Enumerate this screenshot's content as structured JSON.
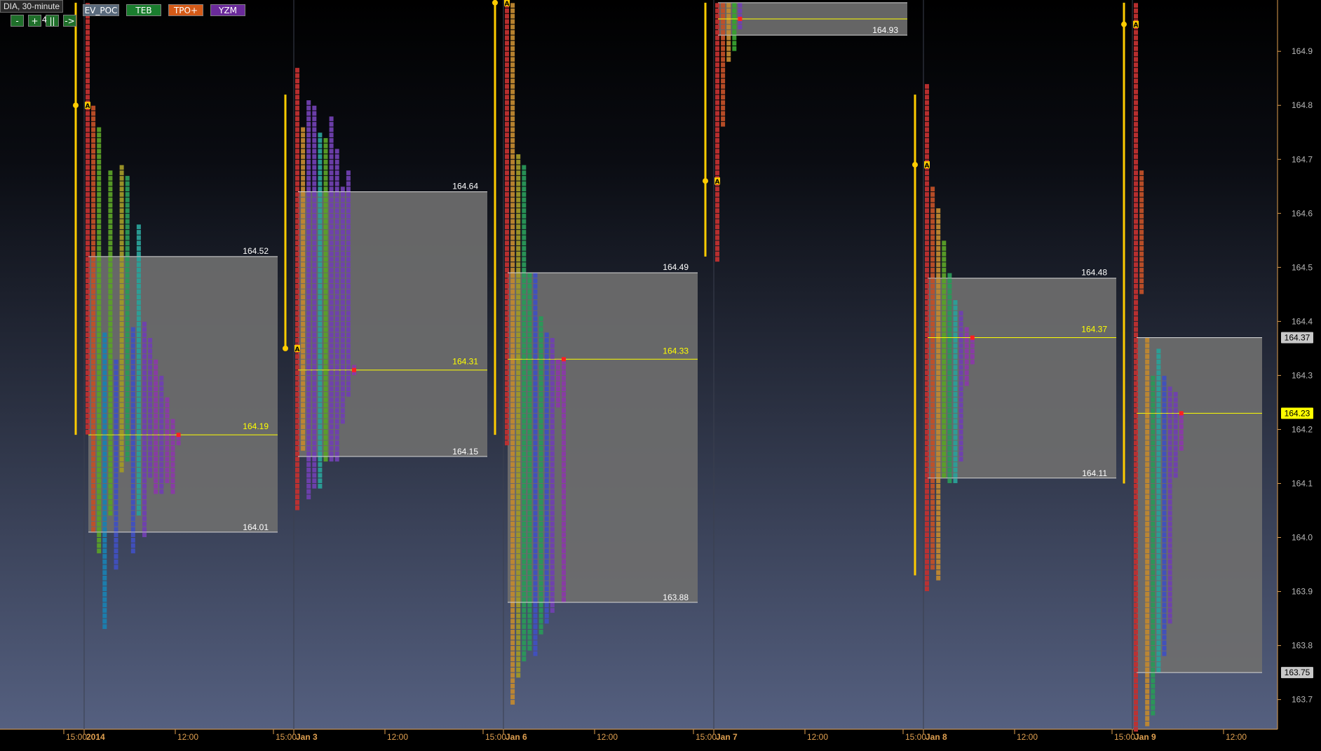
{
  "window": {
    "title": "DIA, 30-minute"
  },
  "toolbar": {
    "buttons": [
      {
        "label": "-",
        "name": "zoom-out-button"
      },
      {
        "label": "+",
        "name": "zoom-in-button"
      },
      {
        "label": "||",
        "name": "pause-button"
      },
      {
        "label": "->",
        "name": "scroll-right-button"
      }
    ],
    "hidden_label": "4",
    "tags": [
      {
        "label": "EV_POC",
        "bg": "#5a6a7c",
        "fg": "#ffffff"
      },
      {
        "label": "TEB",
        "bg": "#1a7d2e",
        "fg": "#ffffff"
      },
      {
        "label": "TPO+",
        "bg": "#d45a18",
        "fg": "#ffffff"
      },
      {
        "label": "YZM",
        "bg": "#6a2a9a",
        "fg": "#ffffff"
      }
    ]
  },
  "colors": {
    "bg_top": "#000000",
    "bg_bottom": "#556080",
    "axis_text": "#e0a050",
    "price_axis_text": "#b8b8b8",
    "value_area": "#6e6e6e",
    "poc_line": "#ffff00",
    "ib_line": "#ffcc00",
    "value_label": "#ffffff",
    "poc_label": "#ffff00",
    "tpo_A": "#c03030",
    "tpo_B": "#c05028",
    "tpo_C": "#c08830",
    "tpo_D": "#a09828",
    "tpo_E": "#5aa028",
    "tpo_F": "#38a030",
    "tpo_G": "#2a9858",
    "tpo_H": "#2aa098",
    "tpo_I": "#1a80b0",
    "tpo_X": "#4050c0",
    "tpo_Y": "#7040b0",
    "tpo_Z": "#8a3aa8",
    "poc_marker": "#ff2020"
  },
  "chart_data": {
    "type": "market-profile",
    "symbol": "DIA",
    "interval": "30-minute",
    "y_axis": {
      "ticks": [
        164.9,
        164.8,
        164.7,
        164.6,
        164.5,
        164.4,
        164.3,
        164.2,
        164.1,
        164.0,
        163.9,
        163.8,
        163.7
      ],
      "range": [
        163.645,
        164.995
      ],
      "highlighted": [
        {
          "value": 164.37,
          "label": "164.37",
          "bg": "#c8c8c8",
          "fg": "#000000"
        },
        {
          "value": 164.23,
          "label": "164.23",
          "bg": "#ffff00",
          "fg": "#000000"
        },
        {
          "value": 163.75,
          "label": "163.75",
          "bg": "#c8c8c8",
          "fg": "#000000"
        }
      ]
    },
    "x_axis": {
      "labels": [
        {
          "text": "15:00",
          "bold": false
        },
        {
          "text": "2014",
          "bold": true
        },
        {
          "text": "12:00",
          "bold": false
        },
        {
          "text": "15:00",
          "bold": false
        },
        {
          "text": "Jan 3",
          "bold": true
        },
        {
          "text": "12:00",
          "bold": false
        },
        {
          "text": "15:00",
          "bold": false
        },
        {
          "text": "Jan 6",
          "bold": true
        },
        {
          "text": "12:00",
          "bold": false
        },
        {
          "text": "15:00",
          "bold": false
        },
        {
          "text": "Jan 7",
          "bold": true
        },
        {
          "text": "12:00",
          "bold": false
        },
        {
          "text": "15:00",
          "bold": false
        },
        {
          "text": "Jan 8",
          "bold": true
        },
        {
          "text": "12:00",
          "bold": false
        },
        {
          "text": "15:00",
          "bold": false
        },
        {
          "text": "Jan 9",
          "bold": true
        },
        {
          "text": "12:00",
          "bold": false
        }
      ]
    },
    "sessions": [
      {
        "date": "2014",
        "value_area_high": 164.52,
        "value_area_low": 164.01,
        "poc": 164.19,
        "vah_label": "164.52",
        "val_label": "164.01",
        "poc_label": "164.19",
        "ib_high": 164.99,
        "ib_low": 164.19,
        "open": 164.8,
        "open_letter": "A",
        "periods": [
          {
            "letter": "A",
            "color": "tpo_A",
            "high": 164.99,
            "low": 164.2
          },
          {
            "letter": "B",
            "color": "tpo_B",
            "high": 164.8,
            "low": 164.02
          },
          {
            "letter": "E",
            "color": "tpo_E",
            "high": 164.76,
            "low": 163.98
          },
          {
            "letter": "I",
            "color": "tpo_I",
            "high": 164.38,
            "low": 163.84
          },
          {
            "letter": "E",
            "color": "tpo_E",
            "high": 164.68,
            "low": 164.05
          },
          {
            "letter": "X",
            "color": "tpo_X",
            "high": 164.33,
            "low": 163.95
          },
          {
            "letter": "D",
            "color": "tpo_D",
            "high": 164.69,
            "low": 164.13
          },
          {
            "letter": "G",
            "color": "tpo_G",
            "high": 164.67,
            "low": 164.15
          },
          {
            "letter": "X",
            "color": "tpo_X",
            "high": 164.39,
            "low": 163.98
          },
          {
            "letter": "H",
            "color": "tpo_H",
            "high": 164.58,
            "low": 164.05
          },
          {
            "letter": "Y",
            "color": "tpo_Y",
            "high": 164.4,
            "low": 164.01
          },
          {
            "letter": "Y",
            "color": "tpo_Y",
            "high": 164.37,
            "low": 164.12
          },
          {
            "letter": "Z",
            "color": "tpo_Z",
            "high": 164.33,
            "low": 164.09
          },
          {
            "letter": "Y",
            "color": "tpo_Y",
            "high": 164.3,
            "low": 164.09
          },
          {
            "letter": "Z",
            "color": "tpo_Z",
            "high": 164.26,
            "low": 164.11
          },
          {
            "letter": "Z",
            "color": "tpo_Z",
            "high": 164.22,
            "low": 164.09
          },
          {
            "letter": "Z",
            "color": "tpo_Z",
            "high": 164.19,
            "low": 164.19
          }
        ]
      },
      {
        "date": "Jan 3",
        "value_area_high": 164.64,
        "value_area_low": 164.15,
        "poc": 164.31,
        "vah_label": "164.64",
        "val_label": "164.15",
        "poc_label": "164.31",
        "ib_high": 164.82,
        "ib_low": 164.35,
        "open": 164.35,
        "open_letter": "A",
        "periods": [
          {
            "letter": "A",
            "color": "tpo_A",
            "high": 164.87,
            "low": 164.06
          },
          {
            "letter": "C",
            "color": "tpo_C",
            "high": 164.76,
            "low": 164.17
          },
          {
            "letter": "Y",
            "color": "tpo_Y",
            "high": 164.81,
            "low": 164.08
          },
          {
            "letter": "Y",
            "color": "tpo_Y",
            "high": 164.8,
            "low": 164.1
          },
          {
            "letter": "H",
            "color": "tpo_H",
            "high": 164.75,
            "low": 164.1
          },
          {
            "letter": "E",
            "color": "tpo_E",
            "high": 164.74,
            "low": 164.15
          },
          {
            "letter": "Y",
            "color": "tpo_Y",
            "high": 164.78,
            "low": 164.15
          },
          {
            "letter": "Y",
            "color": "tpo_Y",
            "high": 164.72,
            "low": 164.15
          },
          {
            "letter": "Y",
            "color": "tpo_Y",
            "high": 164.65,
            "low": 164.22
          },
          {
            "letter": "Y",
            "color": "tpo_Y",
            "high": 164.68,
            "low": 164.27
          },
          {
            "letter": "Z",
            "color": "tpo_Z",
            "high": 164.32,
            "low": 164.32
          }
        ]
      },
      {
        "date": "Jan 6",
        "value_area_high": 164.49,
        "value_area_low": 163.88,
        "poc": 164.33,
        "vah_label": "164.49",
        "val_label": "163.88",
        "poc_label": "164.33",
        "ib_high": 164.99,
        "ib_low": 164.19,
        "open": 164.99,
        "open_letter": "A",
        "periods": [
          {
            "letter": "A",
            "color": "tpo_A",
            "high": 164.99,
            "low": 164.18
          },
          {
            "letter": "C",
            "color": "tpo_C",
            "high": 164.99,
            "low": 163.7
          },
          {
            "letter": "D",
            "color": "tpo_D",
            "high": 164.71,
            "low": 163.75
          },
          {
            "letter": "G",
            "color": "tpo_G",
            "high": 164.69,
            "low": 163.78
          },
          {
            "letter": "G",
            "color": "tpo_G",
            "high": 164.49,
            "low": 163.8
          },
          {
            "letter": "X",
            "color": "tpo_X",
            "high": 164.49,
            "low": 163.79
          },
          {
            "letter": "G",
            "color": "tpo_G",
            "high": 164.41,
            "low": 163.83
          },
          {
            "letter": "X",
            "color": "tpo_X",
            "high": 164.38,
            "low": 163.85
          },
          {
            "letter": "Y",
            "color": "tpo_Y",
            "high": 164.37,
            "low": 163.87
          },
          {
            "letter": "Z",
            "color": "tpo_Z",
            "high": 164.33,
            "low": 164.25
          },
          {
            "letter": "Z",
            "color": "tpo_Z",
            "high": 164.33,
            "low": 163.89
          }
        ]
      },
      {
        "date": "Jan 7",
        "value_area_high": 164.99,
        "value_area_low": 164.93,
        "poc": 164.96,
        "vah_label": "",
        "val_label": "164.93",
        "poc_label": "",
        "ib_high": 164.99,
        "ib_low": 164.52,
        "open": 164.66,
        "open_letter": "A",
        "periods": [
          {
            "letter": "A",
            "color": "tpo_A",
            "high": 164.99,
            "low": 164.52
          },
          {
            "letter": "B",
            "color": "tpo_B",
            "high": 164.99,
            "low": 164.77
          },
          {
            "letter": "C",
            "color": "tpo_C",
            "high": 164.99,
            "low": 164.89
          },
          {
            "letter": "F",
            "color": "tpo_F",
            "high": 164.99,
            "low": 164.91
          },
          {
            "letter": "Y",
            "color": "tpo_Y",
            "high": 164.99,
            "low": 164.95
          }
        ]
      },
      {
        "date": "Jan 8",
        "value_area_high": 164.48,
        "value_area_low": 164.11,
        "poc": 164.37,
        "vah_label": "164.48",
        "val_label": "164.11",
        "poc_label": "164.37",
        "ib_high": 164.82,
        "ib_low": 163.93,
        "open": 164.69,
        "open_letter": "A",
        "periods": [
          {
            "letter": "A",
            "color": "tpo_A",
            "high": 164.84,
            "low": 163.91
          },
          {
            "letter": "B",
            "color": "tpo_B",
            "high": 164.65,
            "low": 163.95
          },
          {
            "letter": "C",
            "color": "tpo_C",
            "high": 164.61,
            "low": 163.93
          },
          {
            "letter": "E",
            "color": "tpo_E",
            "high": 164.55,
            "low": 164.12
          },
          {
            "letter": "G",
            "color": "tpo_G",
            "high": 164.49,
            "low": 164.11
          },
          {
            "letter": "H",
            "color": "tpo_H",
            "high": 164.44,
            "low": 164.11
          },
          {
            "letter": "Y",
            "color": "tpo_Y",
            "high": 164.42,
            "low": 164.15
          },
          {
            "letter": "Z",
            "color": "tpo_Z",
            "high": 164.39,
            "low": 164.29
          },
          {
            "letter": "Z",
            "color": "tpo_Z",
            "high": 164.37,
            "low": 164.33
          }
        ]
      },
      {
        "date": "Jan 9",
        "value_area_high": 164.37,
        "value_area_low": 163.75,
        "poc": 164.23,
        "vah_label": "",
        "val_label": "",
        "poc_label": "",
        "ib_high": 164.99,
        "ib_low": 164.1,
        "open": 164.95,
        "open_letter": "A",
        "periods": [
          {
            "letter": "A",
            "color": "tpo_A",
            "high": 164.99,
            "low": 163.65
          },
          {
            "letter": "B",
            "color": "tpo_B",
            "high": 164.68,
            "low": 164.46
          },
          {
            "letter": "C",
            "color": "tpo_C",
            "high": 164.37,
            "low": 163.66
          },
          {
            "letter": "G",
            "color": "tpo_G",
            "high": 164.3,
            "low": 163.68
          },
          {
            "letter": "H",
            "color": "tpo_H",
            "high": 164.35,
            "low": 163.76
          },
          {
            "letter": "X",
            "color": "tpo_X",
            "high": 164.3,
            "low": 163.79
          },
          {
            "letter": "Y",
            "color": "tpo_Y",
            "high": 164.28,
            "low": 163.85
          },
          {
            "letter": "Y",
            "color": "tpo_Y",
            "high": 164.27,
            "low": 164.12
          },
          {
            "letter": "Z",
            "color": "tpo_Z",
            "high": 164.23,
            "low": 164.17
          }
        ]
      }
    ]
  }
}
